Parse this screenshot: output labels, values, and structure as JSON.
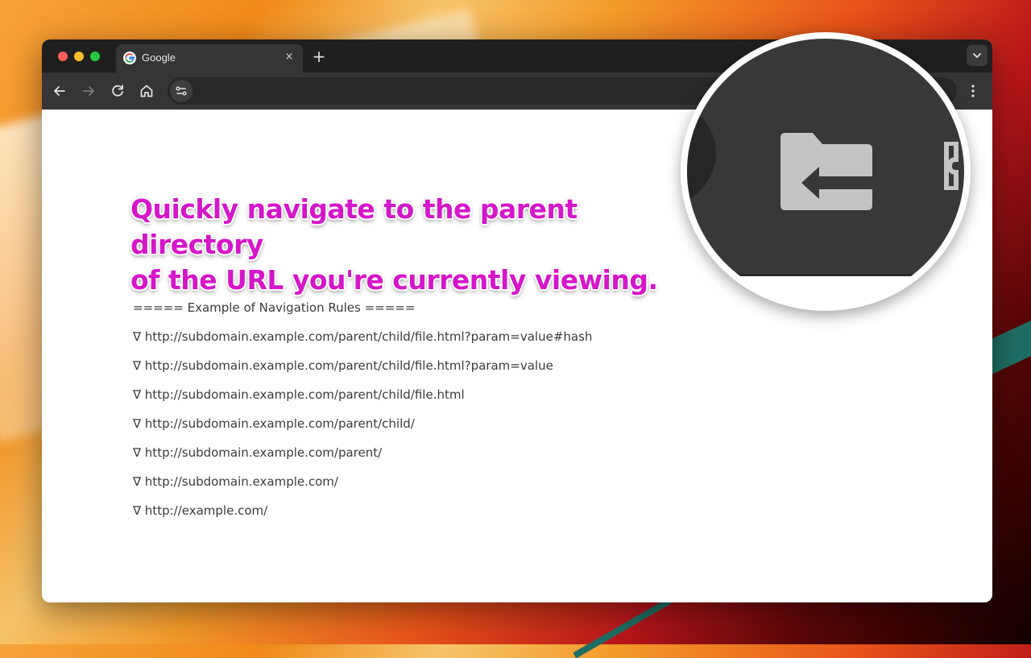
{
  "browser": {
    "tab": {
      "title": "Google",
      "close_glyph": "×",
      "favicon": "google-g-icon"
    },
    "new_tab_glyph": "+",
    "toolbar_icons": [
      "back-arrow-icon",
      "forward-arrow-icon",
      "reload-icon",
      "home-icon",
      "site-info-icon",
      "kebab-menu-icon"
    ]
  },
  "content": {
    "headline_line1": "Quickly navigate to the parent directory",
    "headline_line2": "of the URL you're currently viewing.",
    "rules_title": "===== Example of Navigation Rules =====",
    "rules": [
      "∇ http://subdomain.example.com/parent/child/file.html?param=value#hash",
      "∇ http://subdomain.example.com/parent/child/file.html?param=value",
      "∇ http://subdomain.example.com/parent/child/file.html",
      "∇ http://subdomain.example.com/parent/child/",
      "∇ http://subdomain.example.com/parent/",
      "∇ http://subdomain.example.com/",
      "∇ http://example.com/"
    ]
  },
  "magnifier": {
    "icon": "folder-up-arrow-icon",
    "colors": {
      "bar": "#383838",
      "icon": "#c4c4c4"
    }
  },
  "colors": {
    "headline": "#d516c9",
    "text": "#3b3b3b",
    "tabstrip": "#1f1f1f",
    "toolbar": "#353535"
  }
}
